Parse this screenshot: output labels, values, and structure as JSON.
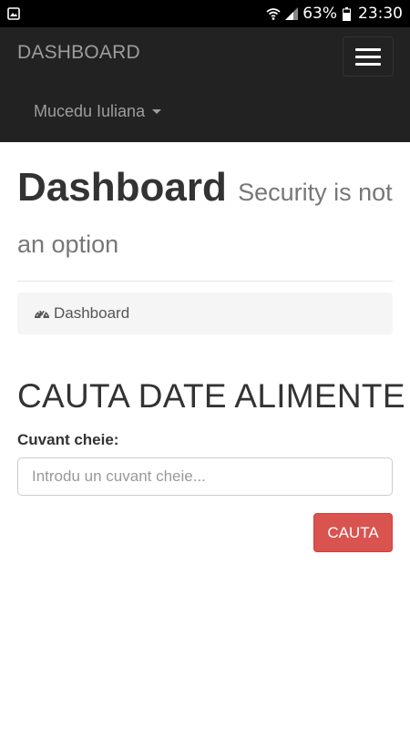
{
  "status_bar": {
    "battery": "63%",
    "time": "23:30",
    "icons": [
      "gallery-icon",
      "wifi-icon",
      "signal-icon",
      "battery-icon"
    ]
  },
  "navbar": {
    "brand": "DASHBOARD",
    "menu_icon": "hamburger-menu-icon",
    "user_name": "Mucedu Iuliana",
    "background": "#222222"
  },
  "header": {
    "title": "Dashboard",
    "subtitle": "Security is not an option"
  },
  "breadcrumb": {
    "icon": "dashboard-icon",
    "label": "Dashboard"
  },
  "search_section": {
    "title": "CAUTA DATE ALIMENTE",
    "field_label": "Cuvant cheie:",
    "input_value": "",
    "input_placeholder": "Introdu un cuvant cheie...",
    "button_label": "CAUTA",
    "button_color": "#d9534f"
  }
}
